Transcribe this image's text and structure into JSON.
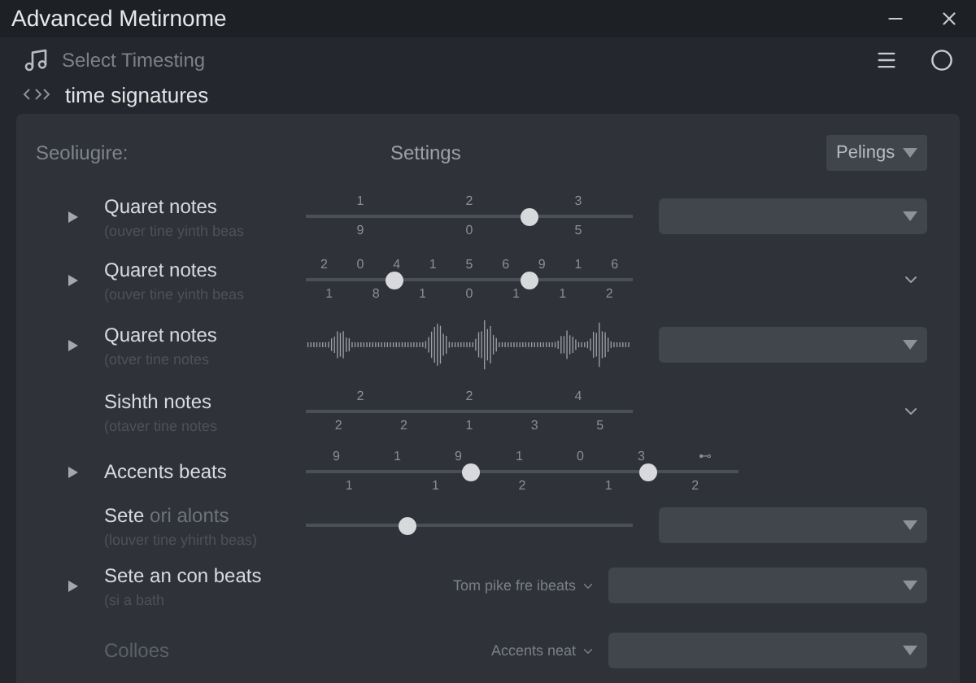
{
  "window": {
    "title": "Advanced Metirnome"
  },
  "header": {
    "subtitle": "Select Timesting",
    "breadcrumb": "time signatures"
  },
  "panel": {
    "label": "Seoliugire:",
    "heading": "Settings",
    "dropdown": "Pelings"
  },
  "rows": [
    {
      "label": "Quaret notes",
      "sublabel": "(ouver tine yinth beas",
      "expandable": true,
      "slider": {
        "kind": "slider",
        "thumbs": [
          {
            "level": 0.68
          }
        ],
        "top_ticks": [
          "1",
          "2",
          "3"
        ],
        "bottom_ticks": [
          "9",
          "0",
          "5"
        ]
      },
      "control": {
        "kind": "dropdown"
      }
    },
    {
      "label": "Quaret notes",
      "sublabel": "(ouver tine yinth beas",
      "expandable": true,
      "slider": {
        "kind": "slider",
        "thumbs": [
          {
            "level": 0.27
          },
          {
            "level": 0.68
          }
        ],
        "top_ticks": [
          "2",
          "0",
          "4",
          "1",
          "5",
          "6",
          "9",
          "1",
          "6"
        ],
        "bottom_ticks": [
          "1",
          "8",
          "1",
          "0",
          "1",
          "1",
          "2"
        ]
      },
      "control": {
        "kind": "chevron"
      }
    },
    {
      "label": "Quaret notes",
      "sublabel": "(otver tine notes",
      "expandable": true,
      "slider": {
        "kind": "wave"
      },
      "control": {
        "kind": "dropdown"
      }
    },
    {
      "label": "Sishth notes",
      "sublabel": "(otaver tine notes",
      "slider": {
        "kind": "slider",
        "top_ticks": [
          "2",
          "2",
          "4"
        ],
        "bottom_ticks": [
          "2",
          "2",
          "1",
          "3",
          "5"
        ]
      },
      "control": {
        "kind": "chevron"
      }
    },
    {
      "label": "Accents beats",
      "expandable": true,
      "slider": {
        "kind": "slider",
        "thumbs": [
          {
            "level": 0.38
          },
          {
            "level": 0.79
          }
        ],
        "top_ticks": [
          "9",
          "1",
          "9",
          "1",
          "0",
          "3",
          "⊷"
        ],
        "bottom_ticks": [
          "1",
          "1",
          "2",
          "1",
          "2"
        ]
      },
      "control": {
        "kind": "none"
      }
    },
    {
      "label": "Sete",
      "label_extra": "ori alonts",
      "sublabel": "(louver tine yhirth beas)",
      "slider": {
        "kind": "slider",
        "thumbs": [
          {
            "level": 0.31
          }
        ]
      },
      "control": {
        "kind": "dropdown"
      }
    },
    {
      "label": "Sete an con beats",
      "sublabel": "(si a bath",
      "expandable": true,
      "slider": {
        "kind": "none"
      },
      "control": {
        "kind": "labeled",
        "label": "Tom pike fre ibeats"
      }
    },
    {
      "label": "Colloes",
      "disabled": true,
      "slider": {
        "kind": "none"
      },
      "control": {
        "kind": "labeled",
        "label": "Accents neat"
      }
    }
  ]
}
